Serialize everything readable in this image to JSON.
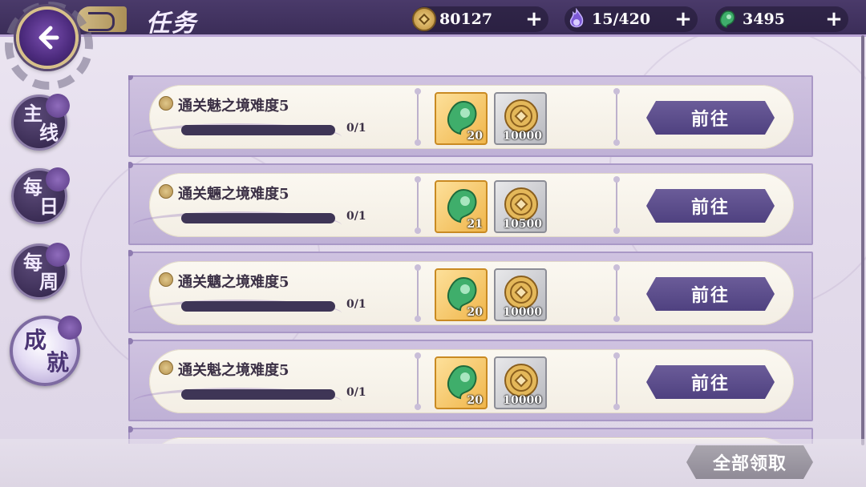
{
  "header": {
    "title": "任务"
  },
  "resources": [
    {
      "name": "coin",
      "value": "80127"
    },
    {
      "name": "stamina",
      "value": "15/420"
    },
    {
      "name": "jade",
      "value": "3495"
    }
  ],
  "tabs": [
    {
      "line1": "主",
      "line2": "线",
      "active": false
    },
    {
      "line1": "每",
      "line2": "日",
      "active": false
    },
    {
      "line1": "每",
      "line2": "周",
      "active": false
    },
    {
      "line1": "成",
      "line2": "就",
      "active": true
    }
  ],
  "quests": [
    {
      "title": "通关魅之境难度5",
      "progress_text": "0/1",
      "progress": 0,
      "rewards": [
        {
          "type": "jade",
          "qty": "20"
        },
        {
          "type": "coin",
          "qty": "10000"
        }
      ],
      "button": "前往"
    },
    {
      "title": "通关魎之境难度5",
      "progress_text": "0/1",
      "progress": 0,
      "rewards": [
        {
          "type": "jade",
          "qty": "21"
        },
        {
          "type": "coin",
          "qty": "10500"
        }
      ],
      "button": "前往"
    },
    {
      "title": "通关魑之境难度5",
      "progress_text": "0/1",
      "progress": 0,
      "rewards": [
        {
          "type": "jade",
          "qty": "20"
        },
        {
          "type": "coin",
          "qty": "10000"
        }
      ],
      "button": "前往"
    },
    {
      "title": "通关魁之境难度5",
      "progress_text": "0/1",
      "progress": 0,
      "rewards": [
        {
          "type": "jade",
          "qty": "20"
        },
        {
          "type": "coin",
          "qty": "10000"
        }
      ],
      "button": "前往"
    }
  ],
  "footer": {
    "claim_all": "全部领取"
  },
  "colors": {
    "accent": "#4f4180",
    "topbar": "#3b2d58",
    "gold": "#d8b45a",
    "jade": "#3fae6b"
  },
  "icons": {
    "back": "back-arrow-icon",
    "coin": "coin-icon",
    "stamina": "spirit-flame-icon",
    "jade": "magatama-icon",
    "plus": "plus-icon"
  }
}
